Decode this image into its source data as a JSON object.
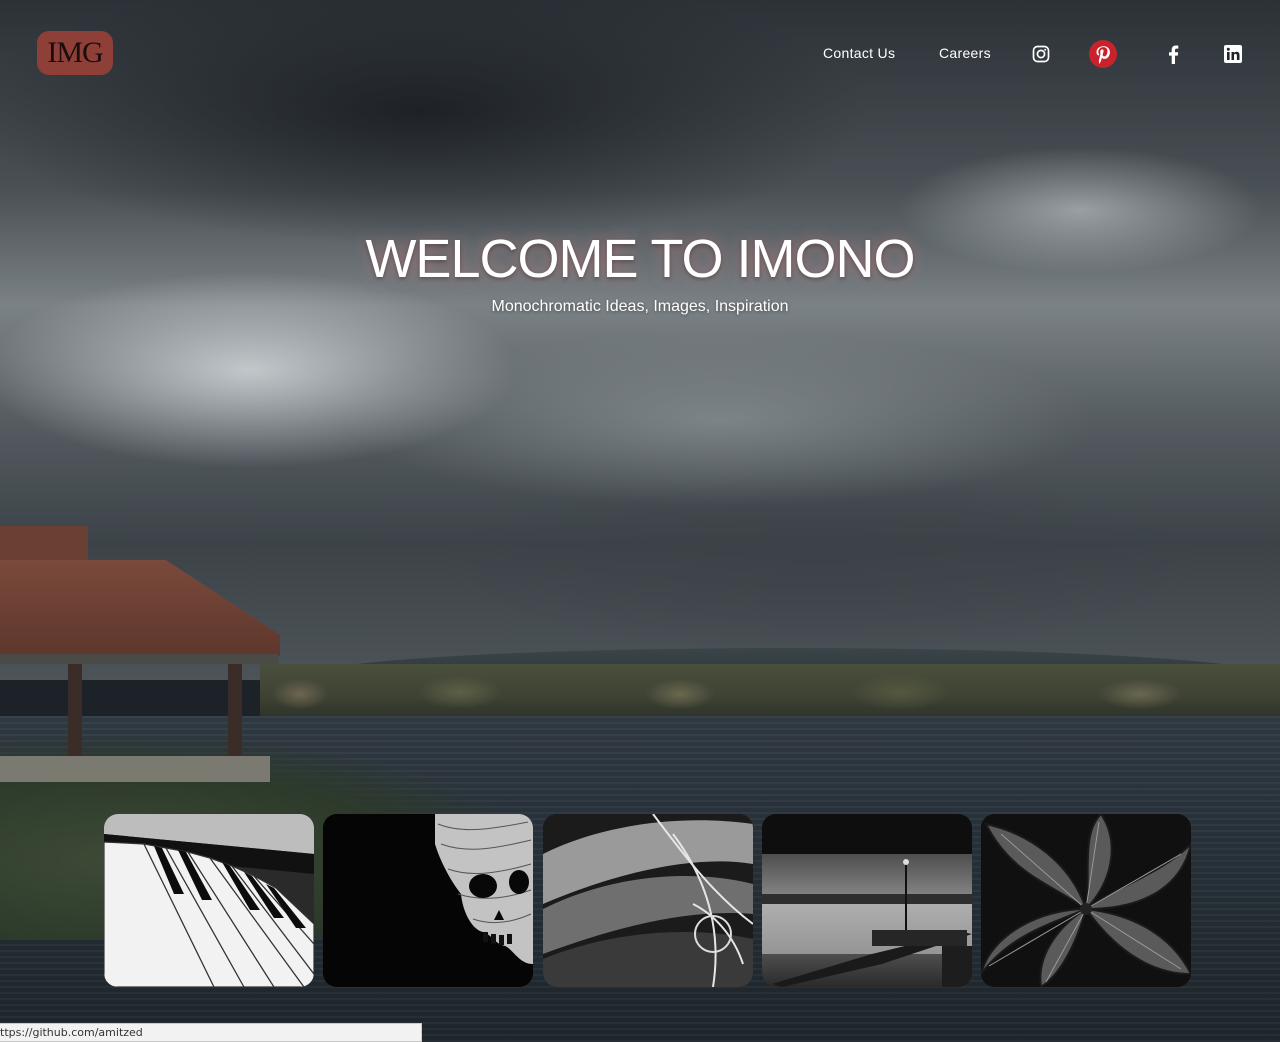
{
  "logo": {
    "text": "IMG"
  },
  "nav": {
    "links": [
      {
        "label": "Contact Us"
      },
      {
        "label": "Careers"
      }
    ],
    "social": [
      {
        "icon": "instagram-icon"
      },
      {
        "icon": "pinterest-icon",
        "color": "#c8232c"
      },
      {
        "icon": "facebook-icon"
      },
      {
        "icon": "linkedin-icon"
      }
    ]
  },
  "hero": {
    "title": "WELCOME TO IMONO",
    "subtitle": "Monochromatic Ideas, Images, Inspiration"
  },
  "gallery": [
    {
      "subject": "piano-keys"
    },
    {
      "subject": "skull"
    },
    {
      "subject": "abstract-curves"
    },
    {
      "subject": "lake-pier"
    },
    {
      "subject": "leaves"
    }
  ],
  "status_bar": {
    "url": "ttps://github.com/amitzed"
  },
  "colors": {
    "brand": "#8d3f38",
    "pinterest": "#c8232c"
  }
}
